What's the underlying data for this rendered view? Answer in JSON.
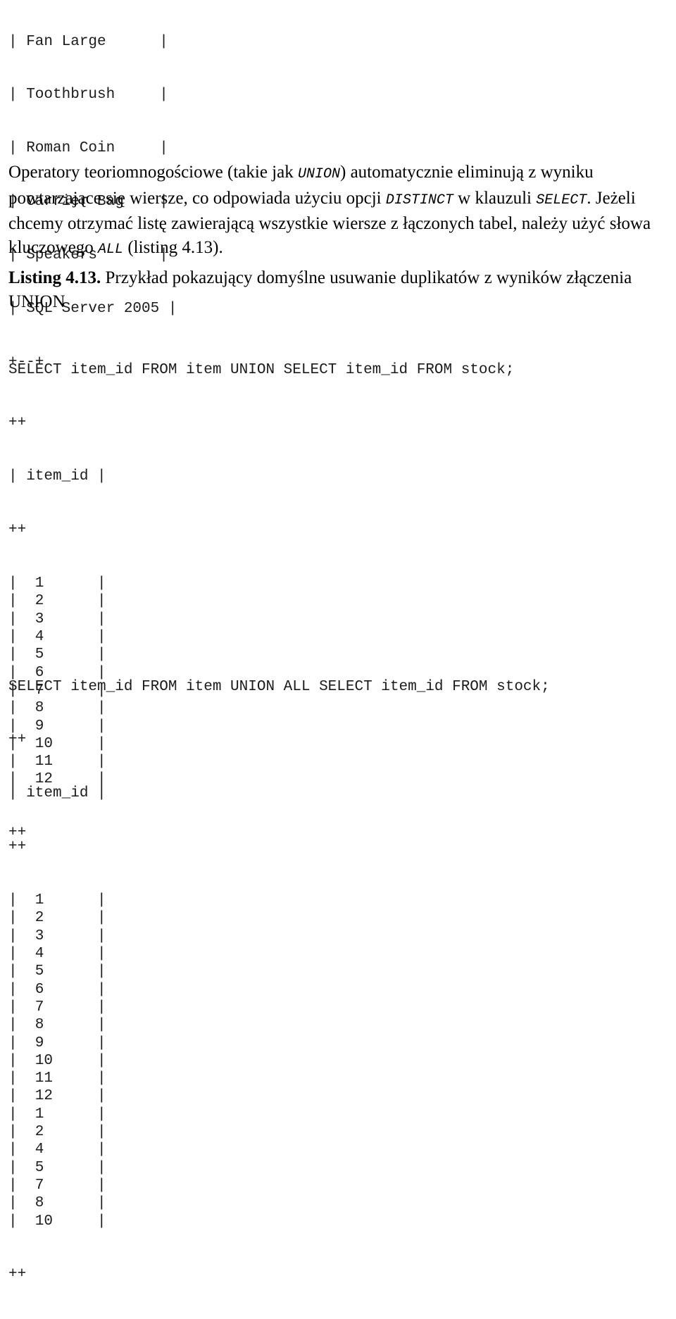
{
  "top_result_table": {
    "name": "item-name-result-fragment",
    "rows": [
      "| Fan Large      |",
      "| Toothbrush     |",
      "| Roman Coin     |",
      "| Carrier Bag    |",
      "| Speakers       |",
      "| SQL Server 2005 |"
    ],
    "bottom_border": "+--+"
  },
  "paragraph": {
    "segments": [
      {
        "type": "text",
        "value": "Operatory teoriomnogościowe (takie jak "
      },
      {
        "type": "code",
        "value": "UNION"
      },
      {
        "type": "text",
        "value": ") automatycznie eliminują z wyniku powtarzające się wiersze, co odpowiada użyciu opcji "
      },
      {
        "type": "code",
        "value": "DISTINCT"
      },
      {
        "type": "text",
        "value": " w klauzuli "
      },
      {
        "type": "code",
        "value": "SELECT"
      },
      {
        "type": "text",
        "value": ". Jeżeli chcemy otrzymać listę zawierającą wszystkie wiersze z łączonych tabel, należy użyć słowa kluczowego "
      },
      {
        "type": "code",
        "value": "ALL"
      },
      {
        "type": "text",
        "value": " (listing 4.13)."
      }
    ]
  },
  "listing_caption": {
    "label": "Listing 4.13.",
    "text": " Przykład pokazujący domyślne usuwanie duplikatów z wyników złączenia UNION"
  },
  "listing_blocks": [
    {
      "name": "union-distinct-example",
      "query": "SELECT item_id FROM item UNION SELECT item_id FROM stock;",
      "border_top": "++",
      "header": "| item_id |",
      "border_mid": "++",
      "values": [
        "1",
        "2",
        "3",
        "4",
        "5",
        "6",
        "7",
        "8",
        "9",
        "10",
        "11",
        "12"
      ],
      "border_bottom": "++"
    },
    {
      "name": "union-all-example",
      "query": "SELECT item_id FROM item UNION ALL SELECT item_id FROM stock;",
      "border_top": "++",
      "header": "| item_id |",
      "border_mid": "++",
      "values": [
        "1",
        "2",
        "3",
        "4",
        "5",
        "6",
        "7",
        "8",
        "9",
        "10",
        "11",
        "12",
        "1",
        "2",
        "4",
        "5",
        "7",
        "8",
        "10"
      ],
      "border_bottom": "++"
    }
  ]
}
